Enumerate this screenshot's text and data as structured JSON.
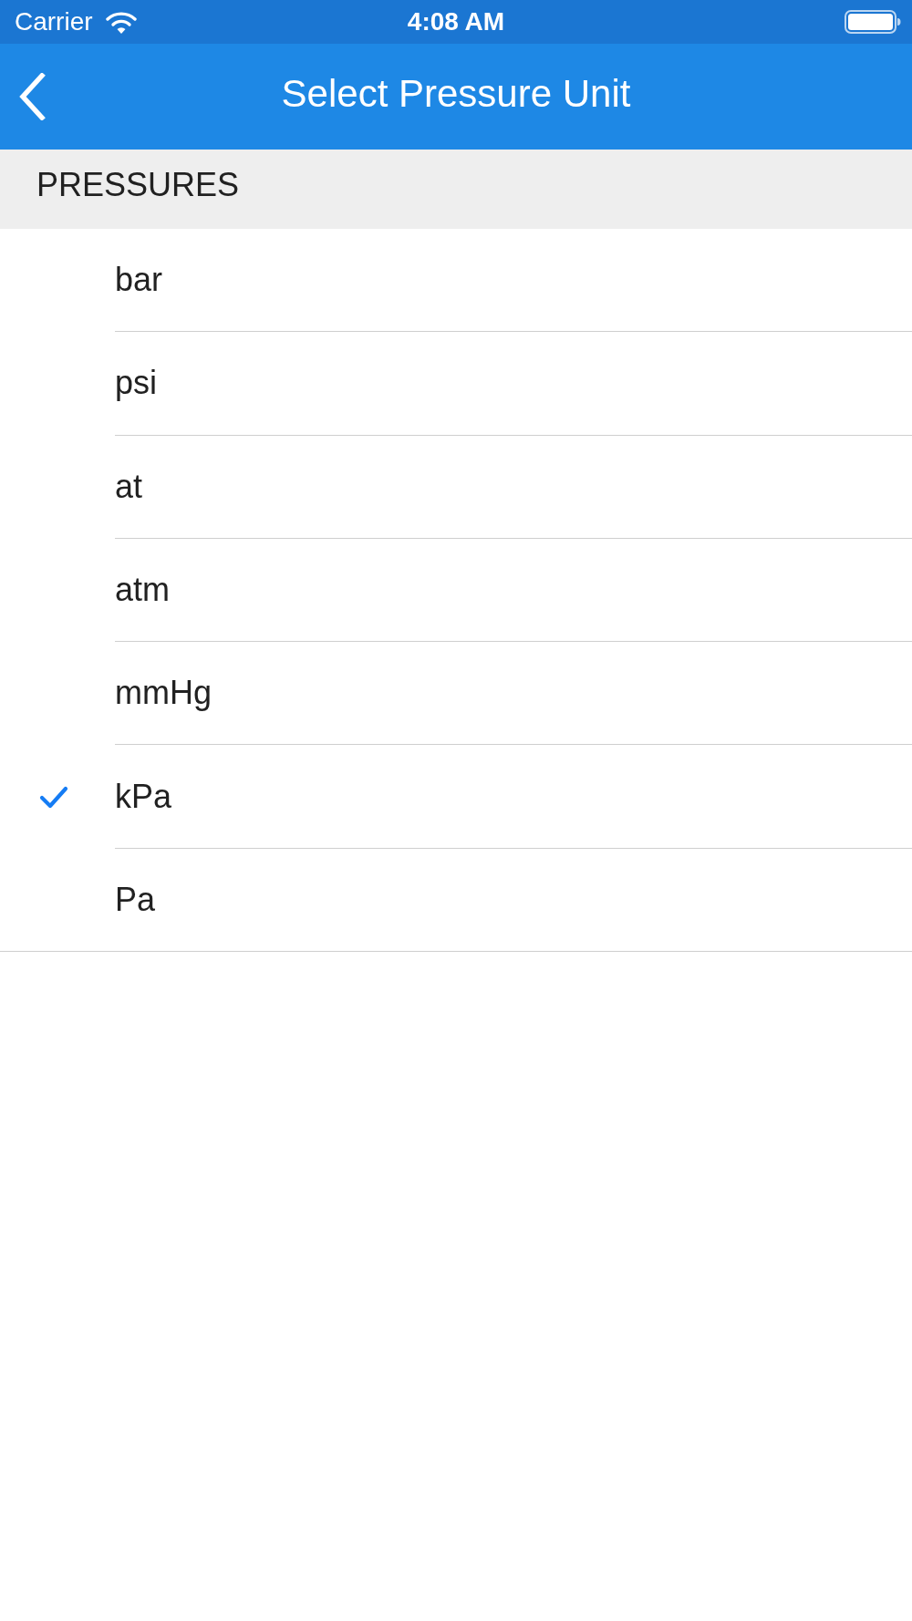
{
  "status_bar": {
    "carrier": "Carrier",
    "time": "4:08 AM"
  },
  "nav_bar": {
    "title": "Select Pressure Unit"
  },
  "section": {
    "header": "PRESSURES",
    "items": [
      {
        "label": "bar",
        "selected": false
      },
      {
        "label": "psi",
        "selected": false
      },
      {
        "label": "at",
        "selected": false
      },
      {
        "label": "atm",
        "selected": false
      },
      {
        "label": "mmHg",
        "selected": false
      },
      {
        "label": "kPa",
        "selected": true
      },
      {
        "label": "Pa",
        "selected": false
      }
    ]
  }
}
